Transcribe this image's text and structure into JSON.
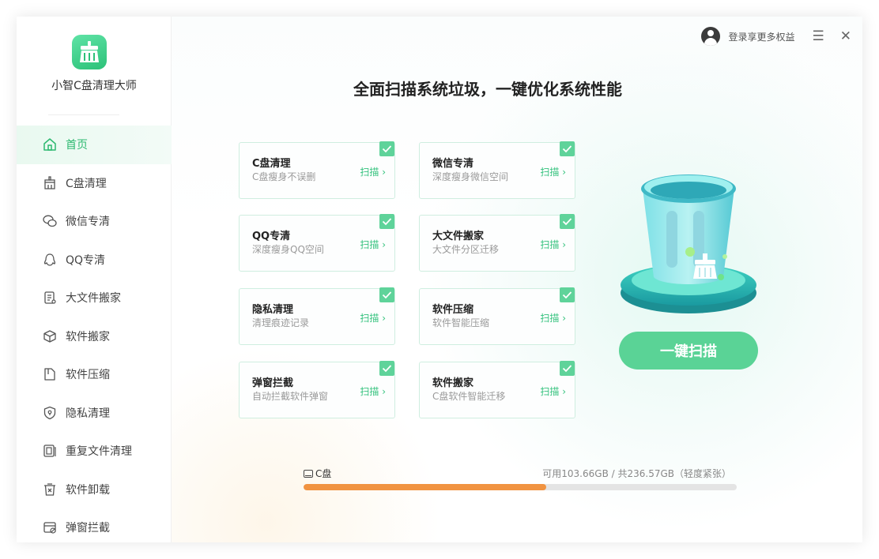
{
  "app": {
    "name": "小智C盘清理大师"
  },
  "colors": {
    "accent": "#5ad396",
    "active_text": "#2db970",
    "usage_bar": "#f19341"
  },
  "sidebar": {
    "items": [
      {
        "label": "首页",
        "icon": "home-icon",
        "active": true
      },
      {
        "label": "C盘清理",
        "icon": "broom-icon",
        "active": false
      },
      {
        "label": "微信专清",
        "icon": "wechat-icon",
        "active": false
      },
      {
        "label": "QQ专清",
        "icon": "qq-icon",
        "active": false
      },
      {
        "label": "大文件搬家",
        "icon": "document-icon",
        "active": false
      },
      {
        "label": "软件搬家",
        "icon": "box-icon",
        "active": false
      },
      {
        "label": "软件压缩",
        "icon": "compress-icon",
        "active": false
      },
      {
        "label": "隐私清理",
        "icon": "shield-icon",
        "active": false
      },
      {
        "label": "重复文件清理",
        "icon": "duplicate-file-icon",
        "active": false
      },
      {
        "label": "软件卸载",
        "icon": "trash-icon",
        "active": false
      },
      {
        "label": "弹窗拦截",
        "icon": "popup-block-icon",
        "active": false
      }
    ]
  },
  "header": {
    "login_text": "登录享更多权益",
    "menu_glyph": "☰",
    "close_glyph": "✕"
  },
  "main": {
    "headline": "全面扫描系统垃圾，一键优化系统性能",
    "cards": [
      {
        "title": "C盘清理",
        "subtitle": "C盘瘦身不误删",
        "action": "扫描 ›",
        "checked": true
      },
      {
        "title": "微信专清",
        "subtitle": "深度瘦身微信空间",
        "action": "扫描 ›",
        "checked": true
      },
      {
        "title": "QQ专清",
        "subtitle": "深度瘦身QQ空间",
        "action": "扫描 ›",
        "checked": true
      },
      {
        "title": "大文件搬家",
        "subtitle": "大文件分区迁移",
        "action": "扫描 ›",
        "checked": true
      },
      {
        "title": "隐私清理",
        "subtitle": "清理痕迹记录",
        "action": "扫描 ›",
        "checked": true
      },
      {
        "title": "软件压缩",
        "subtitle": "软件智能压缩",
        "action": "扫描 ›",
        "checked": true
      },
      {
        "title": "弹窗拦截",
        "subtitle": "自动拦截软件弹窗",
        "action": "扫描 ›",
        "checked": true
      },
      {
        "title": "软件搬家",
        "subtitle": "C盘软件智能迁移",
        "action": "扫描 ›",
        "checked": true
      }
    ],
    "scan_button": "一键扫描"
  },
  "disk": {
    "label": "C盘",
    "info": "可用103.66GB / 共236.57GB（轻度紧张）",
    "used_percent": 56
  }
}
